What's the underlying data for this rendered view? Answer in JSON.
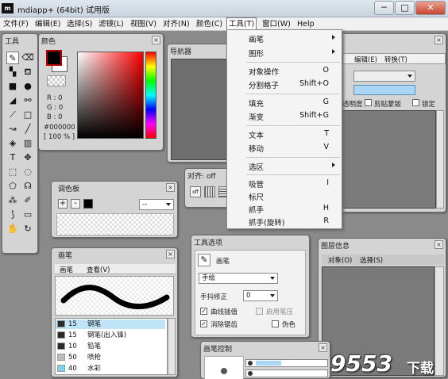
{
  "window": {
    "icon_text": "m",
    "title": "mdiapp+ (64bit) 试用版",
    "minimize": "─",
    "maximize": "□",
    "close": "✕"
  },
  "menubar": [
    "文件(F)",
    "编辑(E)",
    "选择(S)",
    "滤镜(L)",
    "视图(V)",
    "对齐(N)",
    "颜色(C)",
    "工具(T)",
    "窗口(W)",
    "Help"
  ],
  "tool_menu": [
    {
      "label": "画笔",
      "shortcut": "",
      "submenu": true
    },
    {
      "label": "图形",
      "shortcut": "",
      "submenu": true
    },
    {
      "label": "对象操作",
      "shortcut": "O",
      "submenu": false
    },
    {
      "label": "分割格子",
      "shortcut": "Shift+O",
      "submenu": false
    },
    {
      "label": "填充",
      "shortcut": "G",
      "submenu": false
    },
    {
      "label": "渐变",
      "shortcut": "Shift+G",
      "submenu": false
    },
    {
      "label": "文本",
      "shortcut": "T",
      "submenu": false
    },
    {
      "label": "移动",
      "shortcut": "V",
      "submenu": false
    },
    {
      "label": "选区",
      "shortcut": "",
      "submenu": true
    },
    {
      "label": "吸管",
      "shortcut": "I",
      "submenu": false
    },
    {
      "label": "标尺",
      "shortcut": "",
      "submenu": false
    },
    {
      "label": "抓手",
      "shortcut": "H",
      "submenu": false
    },
    {
      "label": "抓手(旋转)",
      "shortcut": "R",
      "submenu": false
    }
  ],
  "tools_panel": {
    "title": "工具"
  },
  "color_panel": {
    "title": "颜色",
    "r": "R : 0",
    "g": "G : 0",
    "b": "B : 0",
    "hex": "#000000",
    "opacity": "[ 100 % ]",
    "fg_color": "#000000",
    "bg_color": "#ffffff"
  },
  "navigator": {
    "title": "导航器"
  },
  "align_panel": {
    "title": "对齐: off",
    "off_label": "off"
  },
  "palette_panel": {
    "title": "调色板",
    "add": "+",
    "remove": "-",
    "select": "--"
  },
  "layer_panel": {
    "menu_edit": "编辑(E)",
    "menu_convert": "转换(T)",
    "opacity_label": "透明度",
    "clip_label": "剪贴蒙版",
    "lock_label": "锁定"
  },
  "brush_panel": {
    "title": "画笔",
    "tab_brush": "画笔",
    "tab_view": "查看(V)",
    "items": [
      {
        "size": "15",
        "name": "钢笔",
        "color": "#2a2a2a",
        "selected": true
      },
      {
        "size": "15",
        "name": "钢笔(出入锋)",
        "color": "#2a2a2a",
        "selected": false
      },
      {
        "size": "10",
        "name": "铅笔",
        "color": "#2a2a2a",
        "selected": false
      },
      {
        "size": "50",
        "name": "喷枪",
        "color": "#bdbdbd",
        "selected": false
      },
      {
        "size": "40",
        "name": "水彩",
        "color": "#7fd2ea",
        "selected": false
      }
    ]
  },
  "tool_options": {
    "title": "工具选项",
    "tool_name": "画笔",
    "mode": "手绘",
    "stabilizer_label": "手抖修正",
    "stabilizer_value": "0",
    "curve_label": "曲线插值",
    "pressure_label": "启用笔压",
    "antialias_label": "消除锯齿",
    "fake_label": "伪色",
    "curve_checked": "✓",
    "antialias_checked": "✓"
  },
  "layer_info": {
    "title": "图层信息",
    "menu_object": "对象(O)",
    "menu_select": "选择(S)"
  },
  "brush_control": {
    "title": "画笔控制"
  },
  "watermark": {
    "main": "9553",
    "suffix": "下载"
  }
}
